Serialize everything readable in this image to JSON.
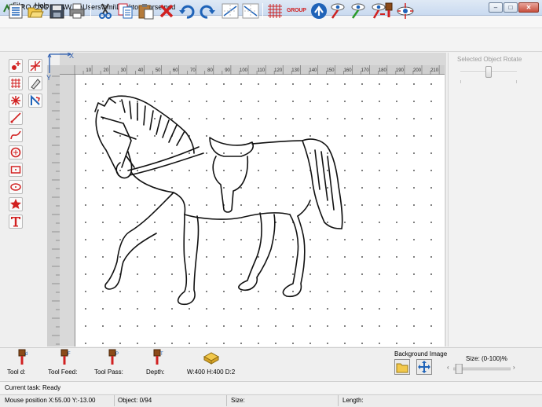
{
  "window": {
    "title": "PRO CNC DRAW C:\\Users\\bmi\\Desktop\\horse.pcd",
    "minimize_glyph": "–",
    "maximize_glyph": "□",
    "close_glyph": "✕"
  },
  "menu": {
    "items": [
      "File",
      "Help"
    ]
  },
  "toolbar": {
    "icons": [
      "list-icon",
      "open-folder-icon",
      "save-icon",
      "print-icon",
      "cut-icon",
      "copy-icon",
      "paste-icon",
      "delete-icon",
      "undo-icon",
      "redo-icon",
      "mirror-horizontal-icon",
      "mirror-vertical-icon",
      "grid-icon",
      "group-icon",
      "flip-icon",
      "probe-icon",
      "probe-check-icon",
      "probe-lock-icon",
      "spindle-icon",
      "center-view-icon"
    ],
    "group_label": "GROUP",
    "accent_red": "#d12020",
    "accent_blue": "#1f63b8"
  },
  "left_tools": [
    "add-point-icon",
    "fit-icon",
    "grid-fill-icon",
    "eraser-icon",
    "asterisk-icon",
    "rotate-corner-icon",
    "line-icon",
    "curve-icon",
    "circle-icon",
    "rectangle-icon",
    "ellipse-icon",
    "star-icon",
    "text-icon"
  ],
  "rulers": {
    "axis_x": "X",
    "axis_y": "Y",
    "top_ticks": [
      "10",
      "20",
      "30",
      "40",
      "50",
      "60",
      "70",
      "80",
      "90",
      "100",
      "110",
      "120",
      "130",
      "140",
      "150",
      "160",
      "170",
      "180",
      "190",
      "200",
      "210"
    ]
  },
  "right_panel": {
    "rotate_label": "Selected Object Rotate",
    "rotate_value": 0.5
  },
  "tool_params": {
    "tool_d": "Tool d:",
    "tool_feed": "Tool Feed:",
    "tool_pass": "Tool Pass:",
    "depth": "Depth:",
    "dimensions": "W:400 H:400 D:2",
    "icon_letters": {
      "d": "d",
      "feed": "F",
      "pass": "P",
      "depth": "T"
    }
  },
  "background_image": {
    "label": "Background Image",
    "size_label": "Size: (0-100)%",
    "size_value": 0.05
  },
  "status": {
    "task": "Current task: Ready",
    "mouse": "Mouse position X:55.00 Y:-13.00",
    "object": "Object: 0/94",
    "size": "Size:",
    "length": "Length:"
  }
}
